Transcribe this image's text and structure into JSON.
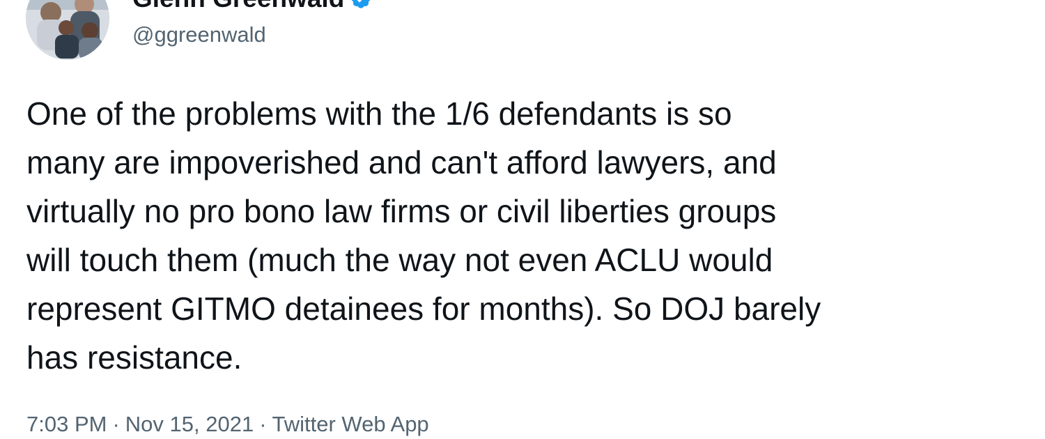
{
  "author": {
    "display_name": "Glenn Greenwald",
    "handle": "@ggreenwald",
    "verified": true,
    "verified_color": "#1d9bf0"
  },
  "tweet": {
    "lines": [
      "One of the problems with the 1/6 defendants is so",
      "many are impoverished and can't afford lawyers, and",
      "virtually no pro bono law firms or civil liberties groups",
      "will touch them (much the way not even ACLU would",
      "represent GITMO detainees for months). So DOJ barely",
      "has resistance."
    ]
  },
  "meta": {
    "time": "7:03 PM",
    "separator": "·",
    "date": "Nov 15, 2021",
    "source": "Twitter Web App"
  },
  "icons": {
    "avatar": "avatar-photo",
    "verified": "verified-badge-icon",
    "more": "more-options-icon"
  },
  "colors": {
    "text_primary": "#0f1419",
    "text_secondary": "#536471",
    "background": "#ffffff"
  }
}
